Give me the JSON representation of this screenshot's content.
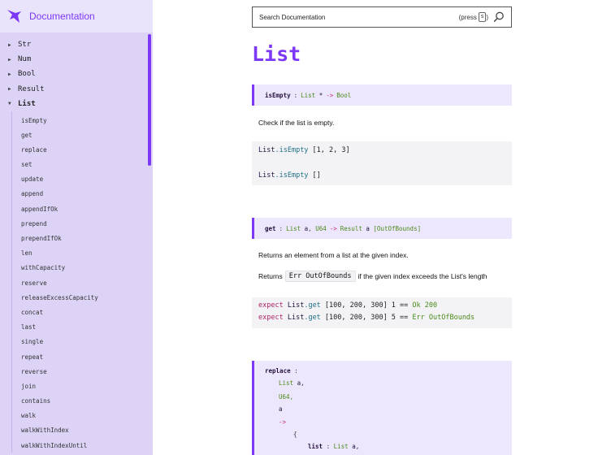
{
  "brand": {
    "title": "Documentation"
  },
  "sidebar": {
    "modules": [
      {
        "label": "Str",
        "open": false
      },
      {
        "label": "Num",
        "open": false
      },
      {
        "label": "Bool",
        "open": false
      },
      {
        "label": "Result",
        "open": false
      },
      {
        "label": "List",
        "open": true
      }
    ],
    "list_entries": [
      "isEmpty",
      "get",
      "replace",
      "set",
      "update",
      "append",
      "appendIfOk",
      "prepend",
      "prependIfOk",
      "len",
      "withCapacity",
      "reserve",
      "releaseExcessCapacity",
      "concat",
      "last",
      "single",
      "repeat",
      "reverse",
      "join",
      "contains",
      "walk",
      "walkWithIndex",
      "walkWithIndexUntil"
    ]
  },
  "search": {
    "placeholder": "Search Documentation",
    "press_label": "(press",
    "key": "s",
    "press_close": ")"
  },
  "page": {
    "title": "List"
  },
  "entries": {
    "isEmpty": {
      "name": "isEmpty",
      "colon": ":",
      "arg": "List",
      "argvar": "*",
      "arrow": "->",
      "ret": "Bool",
      "description": "Check if the list is empty.",
      "example1_mod": "List",
      "example1_fn": ".isEmpty",
      "example1_args": " [1, 2, 3]",
      "example2_mod": "List",
      "example2_fn": ".isEmpty",
      "example2_args": " []"
    },
    "get": {
      "name": "get",
      "colon": ":",
      "arg1": "List",
      "arg1var": "a",
      "comma": ",",
      "arg2": "U64",
      "arrow": "->",
      "ret": "Result",
      "retvar": "a",
      "err": "[OutOfBounds]",
      "description1": "Returns an element from a list at the given index.",
      "description2_pre": "Returns",
      "description2_code": "Err OutOfBounds",
      "description2_post": "if the given index exceeds the List's length",
      "ex1_kw": "expect",
      "ex1_mod": "List",
      "ex1_fn": ".get",
      "ex1_args": " [100, 200, 300] 1 == ",
      "ex1_ok": "Ok 200",
      "ex2_kw": "expect",
      "ex2_mod": "List",
      "ex2_fn": ".get",
      "ex2_args": " [100, 200, 300] 5 == ",
      "ex2_err": "Err OutOfBounds"
    },
    "replace": {
      "name": "replace",
      "colon": ":",
      "l1": "List",
      "l1var": "a,",
      "l2": "U64,",
      "l3": "a",
      "l4": "->",
      "l5": "{",
      "l6_field": "list",
      "l6_colon": ":",
      "l6_type": "List",
      "l6_var": "a,"
    }
  }
}
